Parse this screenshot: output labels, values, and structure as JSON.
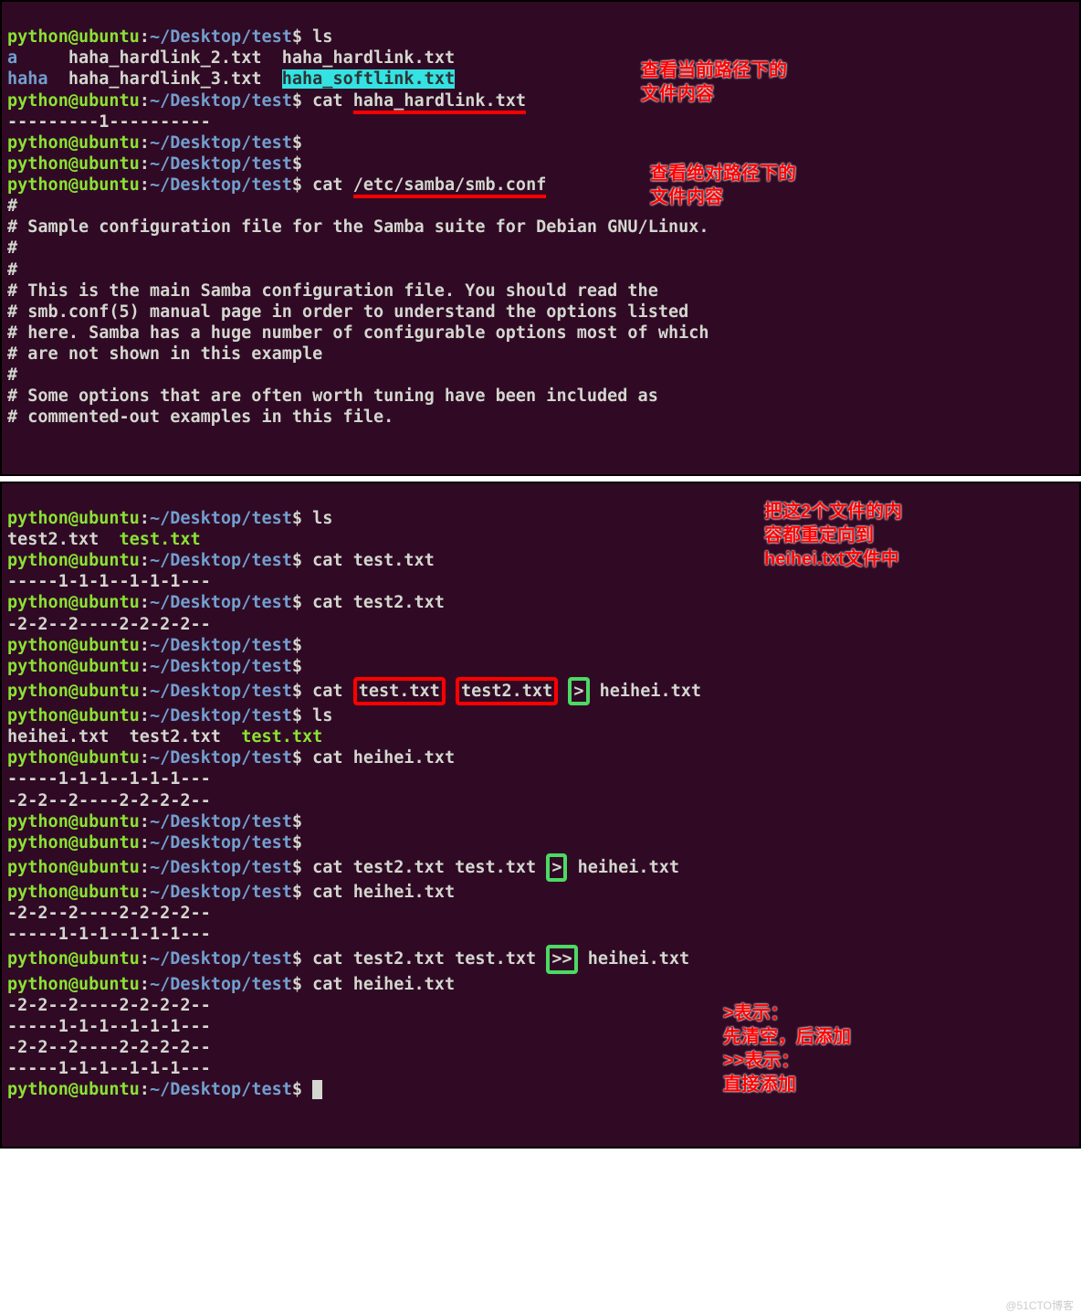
{
  "prompt": {
    "user": "python@ubuntu",
    "sep": ":",
    "path": "~/Desktop/test",
    "dollar": "$"
  },
  "term1": {
    "ls_cmd": " ls",
    "ls_a": "a",
    "ls_hl2": "haha_hardlink_2.txt",
    "ls_hl": "haha_hardlink.txt",
    "ls_haha": "haha",
    "ls_hl3": "haha_hardlink_3.txt",
    "ls_soft": "haha_softlink.txt",
    "cat1_cmd": " cat ",
    "cat1_file": "haha_hardlink.txt",
    "cat1_out": "---------1----------",
    "cat2_cmd": " cat ",
    "cat2_file": "/etc/samba/smb.conf",
    "smb1": "#",
    "smb2": "# Sample configuration file for the Samba suite for Debian GNU/Linux.",
    "smb3": "#",
    "smb4": "#",
    "smb5": "# This is the main Samba configuration file. You should read the",
    "smb6": "# smb.conf(5) manual page in order to understand the options listed",
    "smb7": "# here. Samba has a huge number of configurable options most of which",
    "smb8": "# are not shown in this example",
    "smb9": "#",
    "smb10": "# Some options that are often worth tuning have been included as",
    "smb11": "# commented-out examples in this file.",
    "anno1": "查看当前路径下的文件内容",
    "anno2": "查看绝对路径下的文件内容"
  },
  "term2": {
    "ls_cmd": " ls",
    "ls_out1a": "test2.txt",
    "ls_out1b": "test.txt",
    "cat_t1_cmd": " cat test.txt",
    "cat_t1_out": "-----1-1-1--1-1-1---",
    "cat_t2_cmd": " cat test2.txt",
    "cat_t2_out": "-2-2--2----2-2-2-2--",
    "cat_both_cmd": " cat ",
    "cat_both_f1": "test.txt",
    "cat_both_f2": "test2.txt",
    "cat_both_op": ">",
    "cat_both_target": " heihei.txt",
    "ls2_cmd": " ls",
    "ls2_heihei": "heihei.txt",
    "ls2_test2": "test2.txt",
    "ls2_test": "test.txt",
    "cat_h1_cmd": " cat heihei.txt",
    "cat_h1_out1": "-----1-1-1--1-1-1---",
    "cat_h1_out2": "-2-2--2----2-2-2-2--",
    "cat_rev_cmd": " cat test2.txt test.txt ",
    "cat_rev_op": ">",
    "cat_rev_target": " heihei.txt",
    "cat_h2_cmd": " cat heihei.txt",
    "cat_h2_out1": "-2-2--2----2-2-2-2--",
    "cat_h2_out2": "-----1-1-1--1-1-1---",
    "cat_app_cmd": " cat test2.txt test.txt ",
    "cat_app_op": ">>",
    "cat_app_target": " heihei.txt",
    "cat_h3_cmd": " cat heihei.txt",
    "cat_h3_out1": "-2-2--2----2-2-2-2--",
    "cat_h3_out2": "-----1-1-1--1-1-1---",
    "cat_h3_out3": "-2-2--2----2-2-2-2--",
    "cat_h3_out4": "-----1-1-1--1-1-1---",
    "anno1": "把这2个文件的内容都重定向到heihei.txt文件中",
    "anno2": ">表示：\n先清空，后添加\n>>表示：\n直接添加"
  },
  "watermark": "@51CTO博客"
}
